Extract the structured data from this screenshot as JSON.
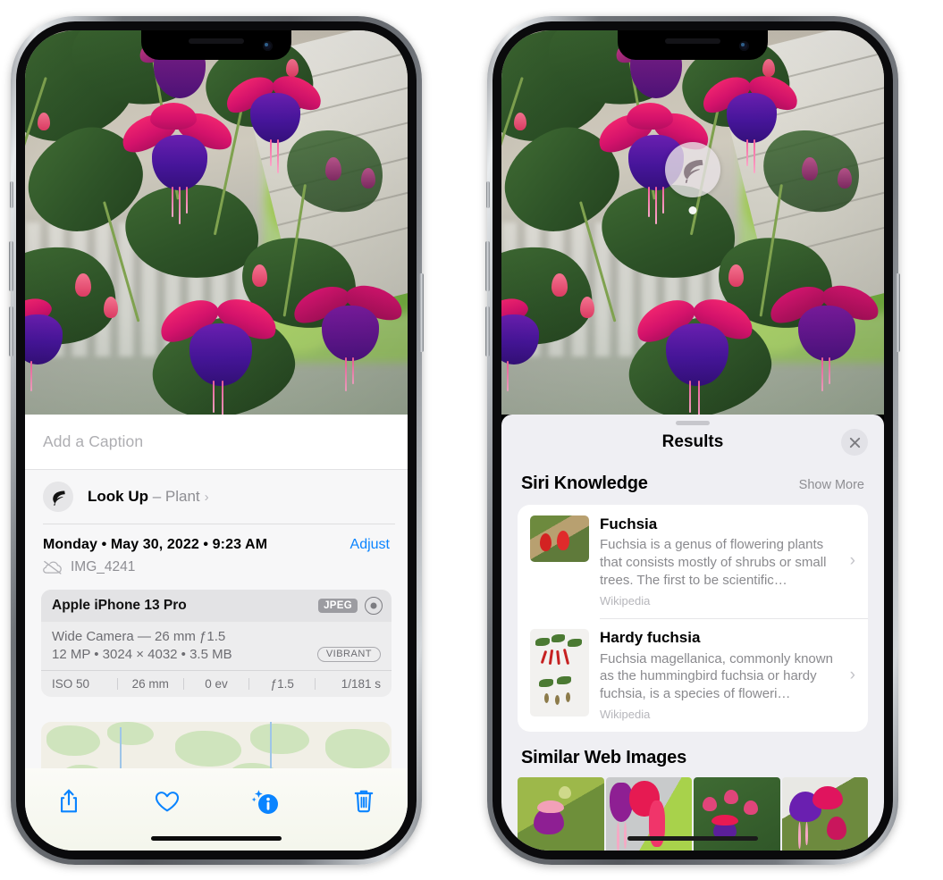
{
  "left_phone": {
    "photo": {
      "alt": "fuchsia-flowers-photo"
    },
    "caption_field": {
      "placeholder": "Add a Caption",
      "value": ""
    },
    "look_up": {
      "icon": "leaf-icon",
      "label": "Look Up",
      "separator": " – ",
      "subject": "Plant",
      "chevron": "›"
    },
    "metadata": {
      "date": "Monday • May 30, 2022 • 9:23 AM",
      "adjust_label": "Adjust",
      "cloud_icon": "cloud-slash-icon",
      "filename": "IMG_4241"
    },
    "exif": {
      "device": "Apple iPhone 13 Pro",
      "format_badge": "JPEG",
      "raw_icon": "raw-aperture-icon",
      "lens_line": "Wide Camera — 26 mm ƒ1.5",
      "size_line": "12 MP • 3024 × 4032 • 3.5 MB",
      "style_badge": "VIBRANT",
      "settings": [
        "ISO 50",
        "26 mm",
        "0 ev",
        "ƒ1.5",
        "1/181 s"
      ]
    },
    "map": {
      "pin": "photo-pin-thumbnail"
    },
    "toolbar": [
      {
        "name": "share-icon",
        "label": "Share"
      },
      {
        "name": "heart-icon",
        "label": "Favorite"
      },
      {
        "name": "info-sparkle-icon",
        "label": "Info"
      },
      {
        "name": "trash-icon",
        "label": "Delete"
      }
    ]
  },
  "right_phone": {
    "photo": {
      "alt": "fuchsia-flowers-photo"
    },
    "leaf_badge": {
      "icon": "leaf-icon"
    },
    "sheet": {
      "title": "Results",
      "close_icon": "close-icon"
    },
    "siri_knowledge": {
      "heading": "Siri Knowledge",
      "action": "Show More",
      "items": [
        {
          "title": "Fuchsia",
          "description": "Fuchsia is a genus of flowering plants that consists mostly of shrubs or small trees. The first to be scientific…",
          "source": "Wikipedia",
          "thumb": "fuchsia-on-fence-thumbnail"
        },
        {
          "title": "Hardy fuchsia",
          "description": "Fuchsia magellanica, commonly known as the hummingbird fuchsia or hardy fuchsia, is a species of floweri…",
          "source": "Wikipedia",
          "thumb": "hardy-fuchsia-specimen-thumbnail"
        }
      ]
    },
    "similar_web_images": {
      "heading": "Similar Web Images",
      "items": [
        {
          "name": "fuchsia-thumb-1"
        },
        {
          "name": "fuchsia-thumb-2"
        },
        {
          "name": "fuchsia-thumb-3"
        },
        {
          "name": "fuchsia-thumb-4"
        }
      ]
    }
  },
  "colors": {
    "accent_blue": "#0a84ff",
    "sheet_bg": "#efeff3",
    "info_bg": "#f7f7f8",
    "secondary_text": "#8e8e93"
  }
}
